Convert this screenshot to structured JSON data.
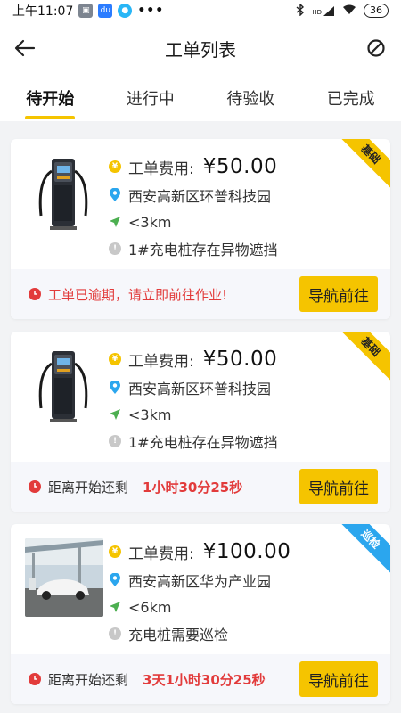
{
  "status_bar": {
    "time": "上午11:07",
    "dots": "•••",
    "hd": "HD",
    "battery": "36"
  },
  "header": {
    "title": "工单列表"
  },
  "tabs": [
    {
      "label": "待开始",
      "active": true
    },
    {
      "label": "进行中",
      "active": false
    },
    {
      "label": "待验收",
      "active": false
    },
    {
      "label": "已完成",
      "active": false
    }
  ],
  "orders": [
    {
      "fee_label": "工单费用:",
      "fee_value": "¥50.00",
      "location": "西安高新区环普科技园",
      "distance": "<3km",
      "issue": "1#充电桩存在异物遮挡",
      "ribbon": "基础",
      "notice": "工单已逾期，请立即前往作业!",
      "nav_label": "导航前往"
    },
    {
      "fee_label": "工单费用:",
      "fee_value": "¥50.00",
      "location": "西安高新区环普科技园",
      "distance": "<3km",
      "issue": "1#充电桩存在异物遮挡",
      "ribbon": "基础",
      "remain_label": "距离开始还剩",
      "remain_time": "1小时30分25秒",
      "nav_label": "导航前往"
    },
    {
      "fee_label": "工单费用:",
      "fee_value": "¥100.00",
      "location": "西安高新区华为产业园",
      "distance": "<6km",
      "issue": "充电桩需要巡检",
      "ribbon": "巡检",
      "remain_label": "距离开始还剩",
      "remain_time": "3天1小时30分25秒",
      "nav_label": "导航前往"
    }
  ],
  "colors": {
    "accent": "#f5c400",
    "alert": "#e23b3b",
    "ribbon_blue": "#2ba6ee",
    "location_blue": "#2ba6ee",
    "distance_green": "#4caf50"
  }
}
